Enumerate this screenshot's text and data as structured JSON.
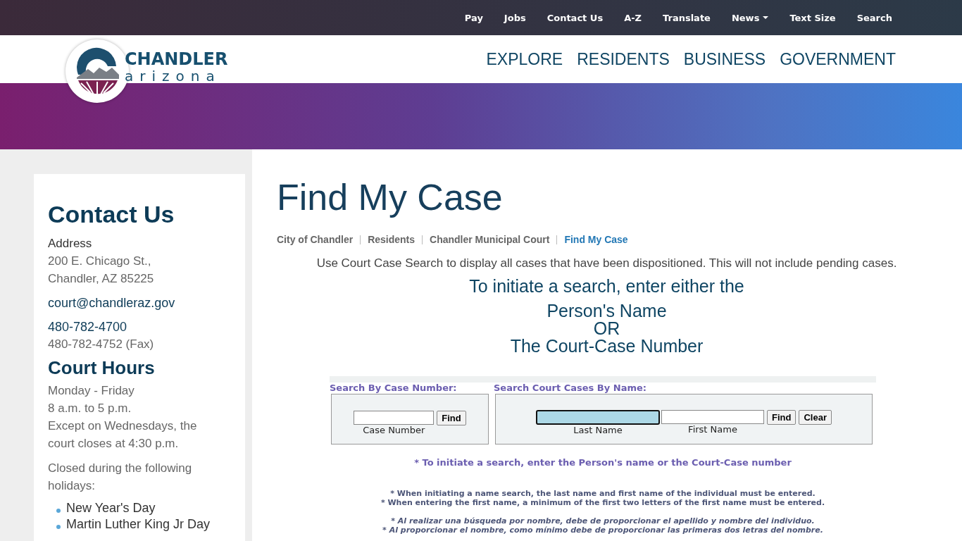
{
  "utility_nav": [
    {
      "label": "Pay"
    },
    {
      "label": "Jobs"
    },
    {
      "label": "Contact Us"
    },
    {
      "label": "A-Z"
    },
    {
      "label": "Translate"
    },
    {
      "label": "News",
      "dropdown": true
    },
    {
      "label": "Text Size"
    },
    {
      "label": "Search"
    }
  ],
  "logo": {
    "name": "CHANDLER",
    "subtitle": "arizona"
  },
  "main_nav": [
    "EXPLORE",
    "RESIDENTS",
    "BUSINESS",
    "GOVERNMENT"
  ],
  "sidebar": {
    "title": "Contact Us",
    "address_label": "Address",
    "address_lines": [
      "200 E. Chicago St.,",
      "Chandler, AZ 85225"
    ],
    "email": "court@chandleraz.gov",
    "phone": "480-782-4700",
    "fax": "480-782-4752 (Fax)",
    "hours_title": "Court Hours",
    "hours_lines": [
      "Monday - Friday",
      "8 a.m. to 5 p.m.",
      "Except on Wednesdays, the court closes at 4:30 p.m."
    ],
    "holidays_intro": "Closed during the following holidays:",
    "holidays": [
      "New Year's Day",
      "Martin Luther King Jr Day"
    ]
  },
  "page_title": "Find My Case",
  "breadcrumbs": [
    {
      "label": "City of Chandler",
      "current": false
    },
    {
      "label": "Residents",
      "current": false
    },
    {
      "label": "Chandler Municipal Court",
      "current": false
    },
    {
      "label": "Find My Case",
      "current": true
    }
  ],
  "intro": "Use Court Case Search to display all cases that have been dispositioned. This will not include pending cases.",
  "instructions_heading": [
    "To initiate a search, enter either the",
    "Person's Name",
    "OR",
    "The Court-Case Number"
  ],
  "case_search": {
    "legend": "Search By Case Number:",
    "fields": [
      {
        "label": "Case Number",
        "focused": false
      }
    ],
    "buttons": [
      "Find"
    ]
  },
  "name_search": {
    "legend": "Search Court Cases By Name:",
    "fields": [
      {
        "label": "Last Name",
        "focused": true
      },
      {
        "label": "First Name",
        "focused": false
      }
    ],
    "buttons": [
      "Find",
      "Clear"
    ]
  },
  "hint": "* To initiate a search, enter the Person's name or the Court-Case number",
  "notes_english": [
    "* When initiating a name search, the last name and first name of the individual must be entered.",
    "* When entering the first name, a minimum of the first two letters of the first name must be entered."
  ],
  "notes_spanish": [
    "* Al realizar una búsqueda por nombre, debe de proporcionar el apellido y nombre del individuo.",
    "* Al proporcionar el nombre, como mínimo debe de proporcionar las primeras dos letras del nombre."
  ]
}
